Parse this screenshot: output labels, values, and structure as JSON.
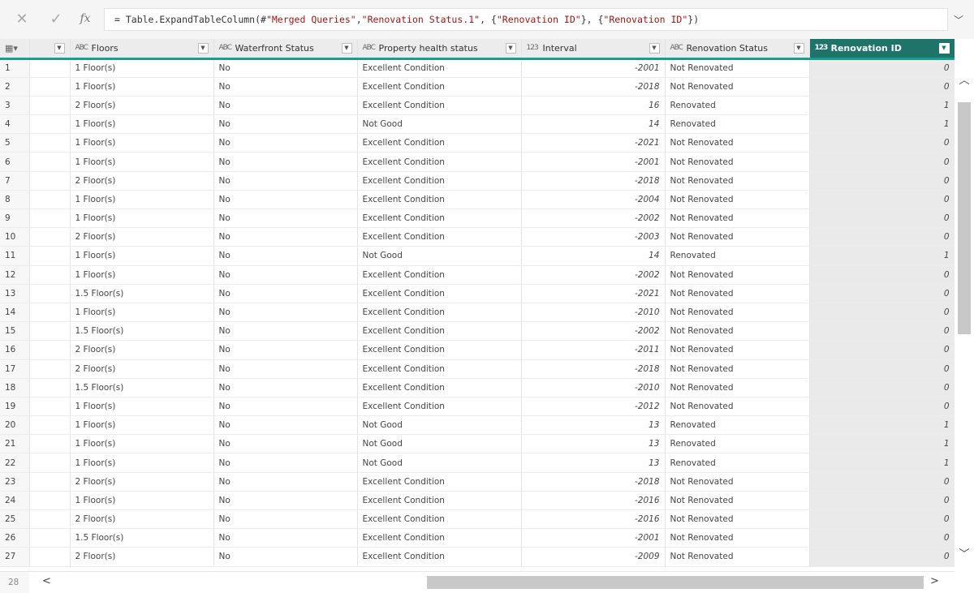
{
  "formula_bar": {
    "cancel_icon": "close-icon",
    "commit_icon": "check-icon",
    "fx_label": "fx",
    "prefix": "= Table.ExpandTableColumn(#",
    "arg1": "\"Merged Queries\"",
    "sep1": ", ",
    "arg2": "\"Renovation Status.1\"",
    "sep2": ", {",
    "arg3": "\"Renovation ID\"",
    "sep3": "}, {",
    "arg4": "\"Renovation ID\"",
    "suffix": "})"
  },
  "columns": [
    {
      "label": "",
      "type_icon": ""
    },
    {
      "label": "Floors",
      "type_icon": "ABC"
    },
    {
      "label": "Waterfront Status",
      "type_icon": "ABC"
    },
    {
      "label": "Property health status",
      "type_icon": "ABC"
    },
    {
      "label": "Interval",
      "type_icon": "123"
    },
    {
      "label": "Renovation Status",
      "type_icon": "ABC"
    },
    {
      "label": "Renovation ID",
      "type_icon": "123"
    }
  ],
  "rows": [
    {
      "n": "1",
      "floors": "1 Floor(s)",
      "waterfront": "No",
      "health": "Excellent Condition",
      "interval": "-2001",
      "status": "Not Renovated",
      "rid": "0"
    },
    {
      "n": "2",
      "floors": "1 Floor(s)",
      "waterfront": "No",
      "health": "Excellent Condition",
      "interval": "-2018",
      "status": "Not Renovated",
      "rid": "0"
    },
    {
      "n": "3",
      "floors": "2 Floor(s)",
      "waterfront": "No",
      "health": "Excellent Condition",
      "interval": "16",
      "status": "Renovated",
      "rid": "1"
    },
    {
      "n": "4",
      "floors": "1 Floor(s)",
      "waterfront": "No",
      "health": "Not Good",
      "interval": "14",
      "status": "Renovated",
      "rid": "1"
    },
    {
      "n": "5",
      "floors": "1 Floor(s)",
      "waterfront": "No",
      "health": "Excellent Condition",
      "interval": "-2021",
      "status": "Not Renovated",
      "rid": "0"
    },
    {
      "n": "6",
      "floors": "1 Floor(s)",
      "waterfront": "No",
      "health": "Excellent Condition",
      "interval": "-2001",
      "status": "Not Renovated",
      "rid": "0"
    },
    {
      "n": "7",
      "floors": "2 Floor(s)",
      "waterfront": "No",
      "health": "Excellent Condition",
      "interval": "-2018",
      "status": "Not Renovated",
      "rid": "0"
    },
    {
      "n": "8",
      "floors": "1 Floor(s)",
      "waterfront": "No",
      "health": "Excellent Condition",
      "interval": "-2004",
      "status": "Not Renovated",
      "rid": "0"
    },
    {
      "n": "9",
      "floors": "1 Floor(s)",
      "waterfront": "No",
      "health": "Excellent Condition",
      "interval": "-2002",
      "status": "Not Renovated",
      "rid": "0"
    },
    {
      "n": "10",
      "floors": "2 Floor(s)",
      "waterfront": "No",
      "health": "Excellent Condition",
      "interval": "-2003",
      "status": "Not Renovated",
      "rid": "0"
    },
    {
      "n": "11",
      "floors": "1 Floor(s)",
      "waterfront": "No",
      "health": "Not Good",
      "interval": "14",
      "status": "Renovated",
      "rid": "1"
    },
    {
      "n": "12",
      "floors": "1 Floor(s)",
      "waterfront": "No",
      "health": "Excellent Condition",
      "interval": "-2002",
      "status": "Not Renovated",
      "rid": "0"
    },
    {
      "n": "13",
      "floors": "1.5 Floor(s)",
      "waterfront": "No",
      "health": "Excellent Condition",
      "interval": "-2021",
      "status": "Not Renovated",
      "rid": "0"
    },
    {
      "n": "14",
      "floors": "1 Floor(s)",
      "waterfront": "No",
      "health": "Excellent Condition",
      "interval": "-2010",
      "status": "Not Renovated",
      "rid": "0"
    },
    {
      "n": "15",
      "floors": "1.5 Floor(s)",
      "waterfront": "No",
      "health": "Excellent Condition",
      "interval": "-2002",
      "status": "Not Renovated",
      "rid": "0"
    },
    {
      "n": "16",
      "floors": "2 Floor(s)",
      "waterfront": "No",
      "health": "Excellent Condition",
      "interval": "-2011",
      "status": "Not Renovated",
      "rid": "0"
    },
    {
      "n": "17",
      "floors": "2 Floor(s)",
      "waterfront": "No",
      "health": "Excellent Condition",
      "interval": "-2018",
      "status": "Not Renovated",
      "rid": "0"
    },
    {
      "n": "18",
      "floors": "1.5 Floor(s)",
      "waterfront": "No",
      "health": "Excellent Condition",
      "interval": "-2010",
      "status": "Not Renovated",
      "rid": "0"
    },
    {
      "n": "19",
      "floors": "1 Floor(s)",
      "waterfront": "No",
      "health": "Excellent Condition",
      "interval": "-2012",
      "status": "Not Renovated",
      "rid": "0"
    },
    {
      "n": "20",
      "floors": "1 Floor(s)",
      "waterfront": "No",
      "health": "Not Good",
      "interval": "13",
      "status": "Renovated",
      "rid": "1"
    },
    {
      "n": "21",
      "floors": "1 Floor(s)",
      "waterfront": "No",
      "health": "Not Good",
      "interval": "13",
      "status": "Renovated",
      "rid": "1"
    },
    {
      "n": "22",
      "floors": "1 Floor(s)",
      "waterfront": "No",
      "health": "Not Good",
      "interval": "13",
      "status": "Renovated",
      "rid": "1"
    },
    {
      "n": "23",
      "floors": "2 Floor(s)",
      "waterfront": "No",
      "health": "Excellent Condition",
      "interval": "-2018",
      "status": "Not Renovated",
      "rid": "0"
    },
    {
      "n": "24",
      "floors": "1 Floor(s)",
      "waterfront": "No",
      "health": "Excellent Condition",
      "interval": "-2016",
      "status": "Not Renovated",
      "rid": "0"
    },
    {
      "n": "25",
      "floors": "2 Floor(s)",
      "waterfront": "No",
      "health": "Excellent Condition",
      "interval": "-2016",
      "status": "Not Renovated",
      "rid": "0"
    },
    {
      "n": "26",
      "floors": "1.5 Floor(s)",
      "waterfront": "No",
      "health": "Excellent Condition",
      "interval": "-2001",
      "status": "Not Renovated",
      "rid": "0"
    },
    {
      "n": "27",
      "floors": "2 Floor(s)",
      "waterfront": "No",
      "health": "Excellent Condition",
      "interval": "-2009",
      "status": "Not Renovated",
      "rid": "0"
    }
  ],
  "last_row_number": "28",
  "colors": {
    "active_header": "#1e7468",
    "header_underline": "#1a9d8f",
    "selected_column": "#eaeaea"
  }
}
